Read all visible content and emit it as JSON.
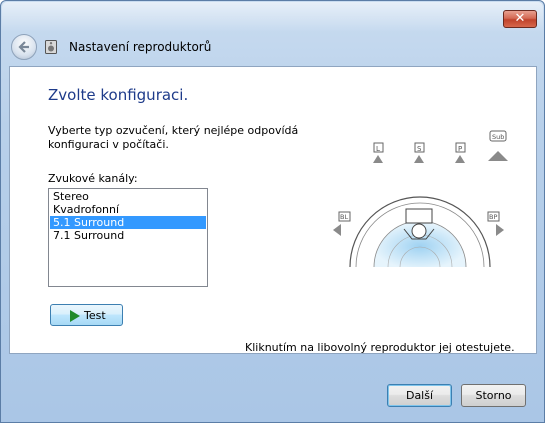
{
  "window": {
    "title": "Nastavení reproduktorů",
    "close_label": "✕"
  },
  "page": {
    "heading": "Zvolte konfiguraci.",
    "description": "Vyberte typ ozvučení, který nejlépe odpovídá konfiguraci v počítači.",
    "channels_label": "Zvukové kanály:",
    "channels": [
      {
        "label": "Stereo",
        "selected": false
      },
      {
        "label": "Kvadrofonní",
        "selected": false
      },
      {
        "label": "5.1 Surround",
        "selected": true
      },
      {
        "label": "7.1 Surround",
        "selected": false
      }
    ],
    "test_button": "Test",
    "hint": "Kliknutím na libovolný reproduktor jej otestujete.",
    "speakers": {
      "L": "L",
      "C": "S",
      "R": "P",
      "SUB": "Sub",
      "BL": "BL",
      "BR": "BP"
    }
  },
  "footer": {
    "next": "Další",
    "cancel": "Storno"
  },
  "colors": {
    "accent": "#1e3b8a",
    "selection": "#3399ff",
    "play": "#1f8a2a"
  }
}
